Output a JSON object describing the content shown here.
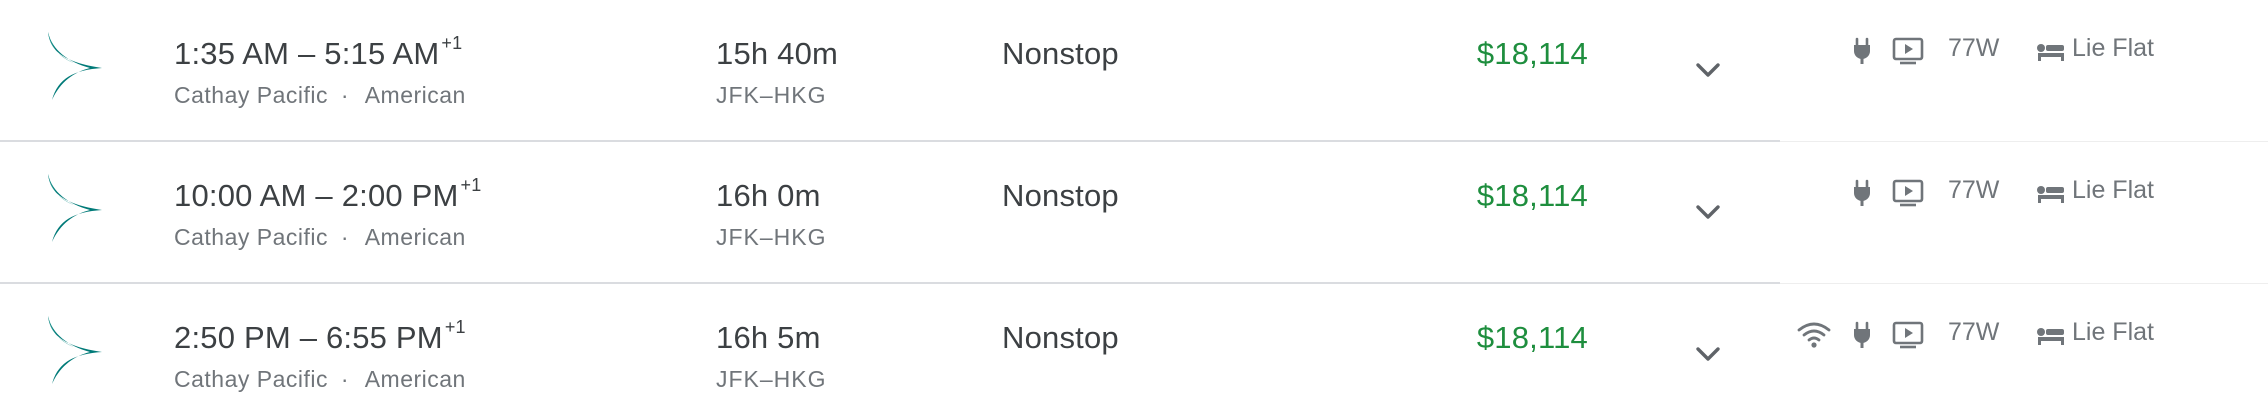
{
  "colors": {
    "price_green": "#1e8e3e",
    "primary_text": "#3c4043",
    "secondary_text": "#70757a",
    "amenity_panel_bg": "#eeeeee",
    "logo_teal": "#007a78"
  },
  "flights": [
    {
      "logo_icon": "cathay-pacific-logo",
      "depart": "1:35 AM",
      "dash": "–",
      "arrive": "5:15 AM",
      "day_offset": "+1",
      "airline": "Cathay Pacific",
      "separator": "·",
      "operator": "American",
      "duration": "15h 40m",
      "route": "JFK–HKG",
      "stops": "Nonstop",
      "price": "$18,114",
      "expand_icon": "chevron-down-icon",
      "amenities": {
        "wifi": false,
        "power": true,
        "video": true,
        "aircraft": "77W",
        "seat_icon": "lie-flat-seat-icon",
        "seat": "Lie Flat"
      }
    },
    {
      "logo_icon": "cathay-pacific-logo",
      "depart": "10:00 AM",
      "dash": "–",
      "arrive": "2:00 PM",
      "day_offset": "+1",
      "airline": "Cathay Pacific",
      "separator": "·",
      "operator": "American",
      "duration": "16h 0m",
      "route": "JFK–HKG",
      "stops": "Nonstop",
      "price": "$18,114",
      "expand_icon": "chevron-down-icon",
      "amenities": {
        "wifi": false,
        "power": true,
        "video": true,
        "aircraft": "77W",
        "seat_icon": "lie-flat-seat-icon",
        "seat": "Lie Flat"
      }
    },
    {
      "logo_icon": "cathay-pacific-logo",
      "depart": "2:50 PM",
      "dash": "–",
      "arrive": "6:55 PM",
      "day_offset": "+1",
      "airline": "Cathay Pacific",
      "separator": "·",
      "operator": "American",
      "duration": "16h 5m",
      "route": "JFK–HKG",
      "stops": "Nonstop",
      "price": "$18,114",
      "expand_icon": "chevron-down-icon",
      "amenities": {
        "wifi": true,
        "power": true,
        "video": true,
        "aircraft": "77W",
        "seat_icon": "lie-flat-seat-icon",
        "seat": "Lie Flat"
      }
    }
  ]
}
